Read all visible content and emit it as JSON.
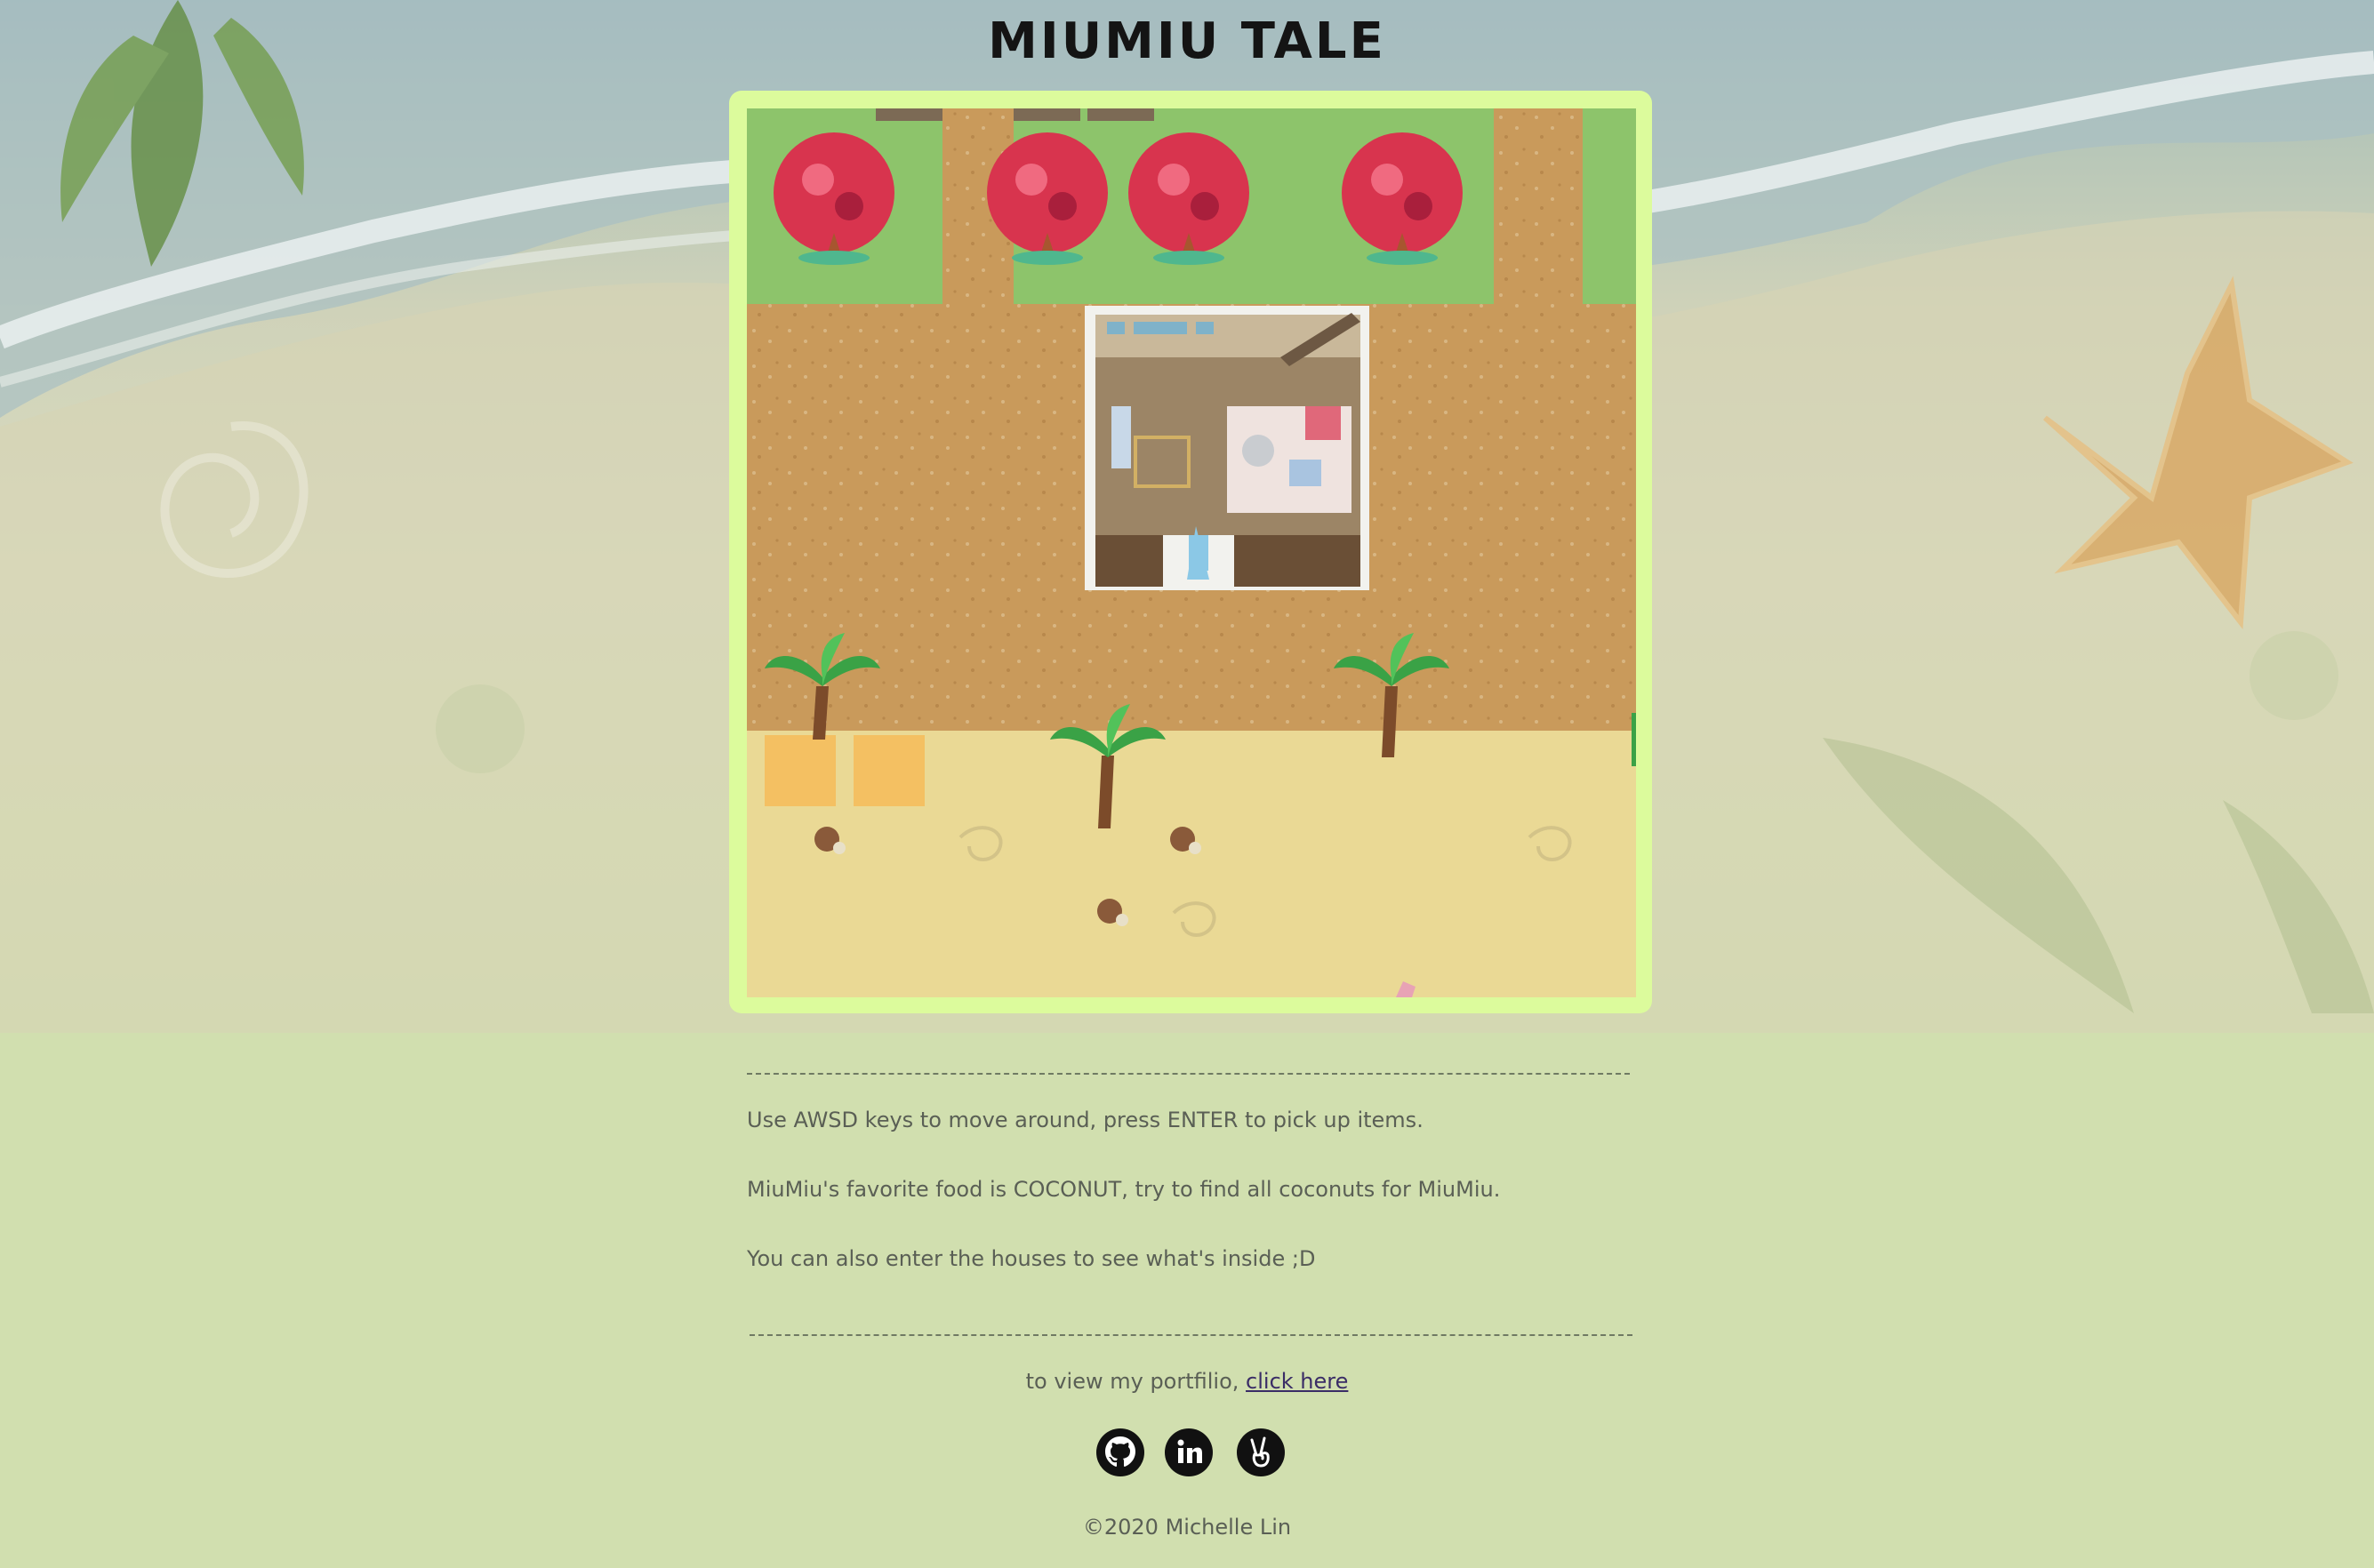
{
  "page": {
    "title": "MIUMIU TALE"
  },
  "game": {
    "name": "game-canvas"
  },
  "info": {
    "line1": "Use AWSD keys to move around, press ENTER to pick up items.",
    "line2": "MiuMiu's favorite food is COCONUT, try to find all coconuts for MiuMiu.",
    "line3": "You can also enter the houses to see what's inside ;D"
  },
  "footer": {
    "portfolio_text": "to view my portfilio,",
    "portfolio_link": "click here",
    "socials": [
      {
        "icon": "github-icon"
      },
      {
        "icon": "linkedin-icon"
      },
      {
        "icon": "peace-hand-icon"
      }
    ],
    "copyright": "©2020 Michelle Lin"
  },
  "colors": {
    "page_bg": "#d1dfaf",
    "frame": "#dcfb9c",
    "grass": "#8dc46b",
    "dirt": "#c99a5b",
    "sand": "#ead995",
    "text": "#5a5f55",
    "link": "#3a2c66"
  }
}
